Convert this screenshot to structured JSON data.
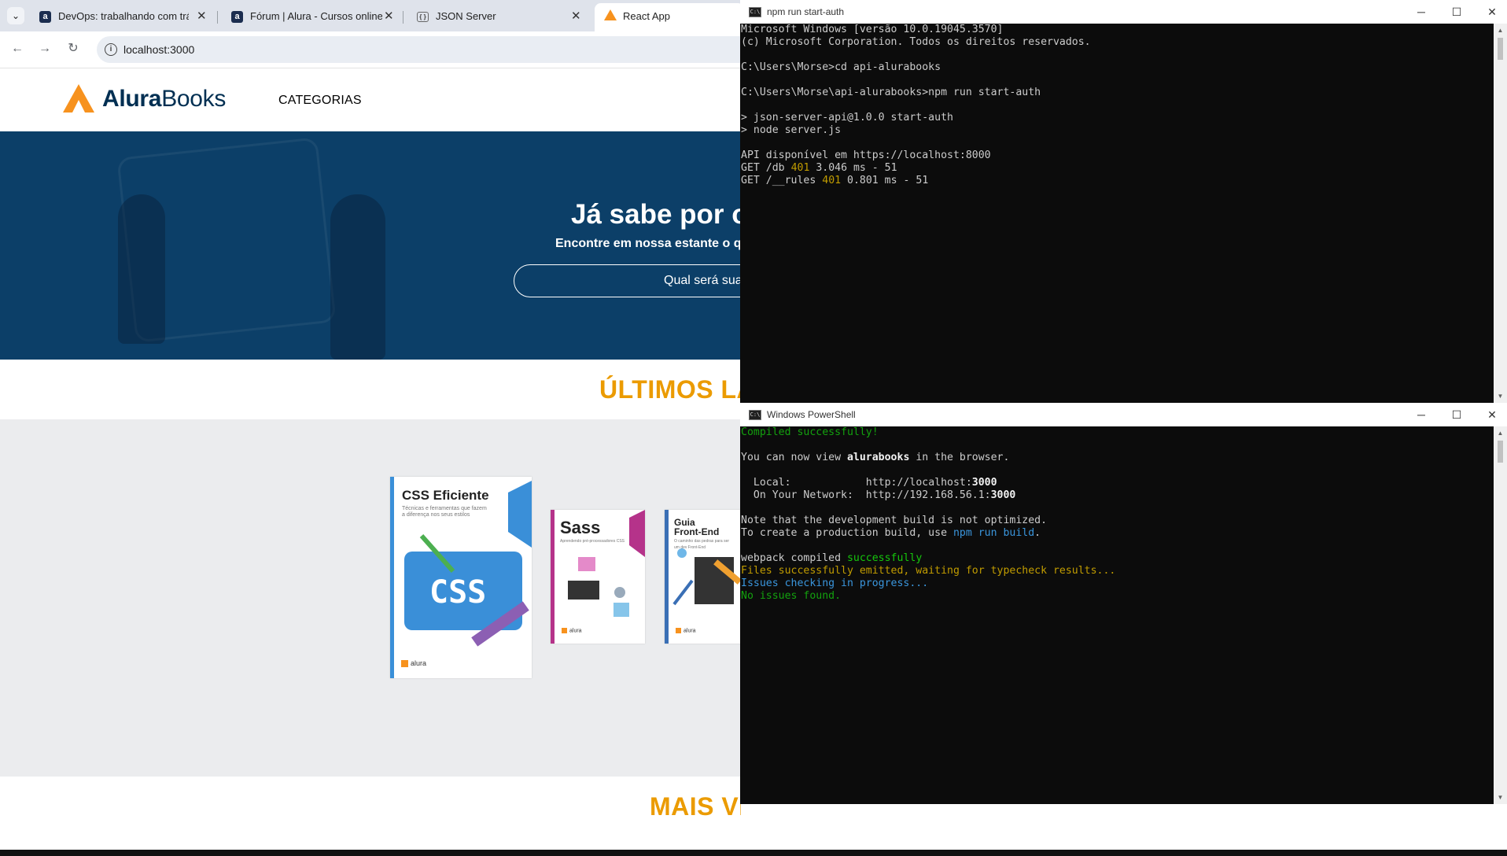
{
  "browser": {
    "tabs": [
      {
        "title": "DevOps: trabalhando com tráfego",
        "favicon": "alura-a-icon"
      },
      {
        "title": "Fórum | Alura - Cursos online de",
        "favicon": "alura-a-icon"
      },
      {
        "title": "JSON Server",
        "favicon": "json-icon"
      },
      {
        "title": "React App",
        "favicon": "react-app-icon"
      }
    ],
    "url": "localhost:3000"
  },
  "site": {
    "logo_strong": "Alura",
    "logo_light": "Books",
    "nav_categories": "CATEGORIAS",
    "hero_title": "Já sabe por onde começar?",
    "hero_subtitle": "Encontre em nossa estante o que precisa para seu desenvolvimento!",
    "search_placeholder": "Qual será sua próxima leitura?",
    "section_latest": "ÚLTIMOS LANÇAMENTOS",
    "section_bestsellers": "MAIS VENDIDOS",
    "books": [
      {
        "title": "CSS Eficiente",
        "subtitle": "Técnicas e ferramentas que fazem a diferença nos seus estilos",
        "publisher": "alura",
        "accent": "#3a8fd8"
      },
      {
        "title": "Sass",
        "subtitle": "Aprendendo pré-processadores CSS",
        "publisher": "alura",
        "accent": "#b5338a"
      },
      {
        "title": "Guia Front-End",
        "subtitle": "O caminho das pedras para ser um dev Front-End",
        "publisher": "alura",
        "accent": "#3a6fb5"
      }
    ]
  },
  "terminal1": {
    "title": "npm run start-auth",
    "lines": [
      "Microsoft Windows [versão 10.0.19045.3570]",
      "(c) Microsoft Corporation. Todos os direitos reservados.",
      "",
      "C:\\Users\\Morse>cd api-alurabooks",
      "",
      "C:\\Users\\Morse\\api-alurabooks>npm run start-auth",
      "",
      "> json-server-api@1.0.0 start-auth",
      "> node server.js",
      "",
      "API disponível em https://localhost:8000"
    ],
    "requests": [
      {
        "method": "GET",
        "path": "/db",
        "status": "401",
        "rest": "3.046 ms - 51"
      },
      {
        "method": "GET",
        "path": "/__rules",
        "status": "401",
        "rest": "0.801 ms - 51"
      }
    ]
  },
  "terminal2": {
    "title": "Windows PowerShell",
    "compiled": "Compiled successfully!",
    "view_prefix": "You can now view ",
    "app_name": "alurabooks",
    "view_suffix": " in the browser.",
    "local_label": "  Local:            ",
    "local_url_prefix": "http://localhost:",
    "local_port": "3000",
    "network_label": "  On Your Network:  ",
    "network_url_prefix": "http://192.168.56.1:",
    "network_port": "3000",
    "note1": "Note that the development build is not optimized.",
    "note2_prefix": "To create a production build, use ",
    "note2_cmd": "npm run build",
    "note2_suffix": ".",
    "webpack_prefix": "webpack compiled ",
    "webpack_status": "successfully",
    "files_emitted": "Files successfully emitted, waiting for typecheck results...",
    "issues_checking": "Issues checking in progress...",
    "no_issues": "No issues found."
  },
  "colors": {
    "alura_orange": "#f7921e",
    "section_title": "#eb9b00",
    "hero_bg": "#0c3f68",
    "terminal_bg": "#0c0c0c"
  }
}
